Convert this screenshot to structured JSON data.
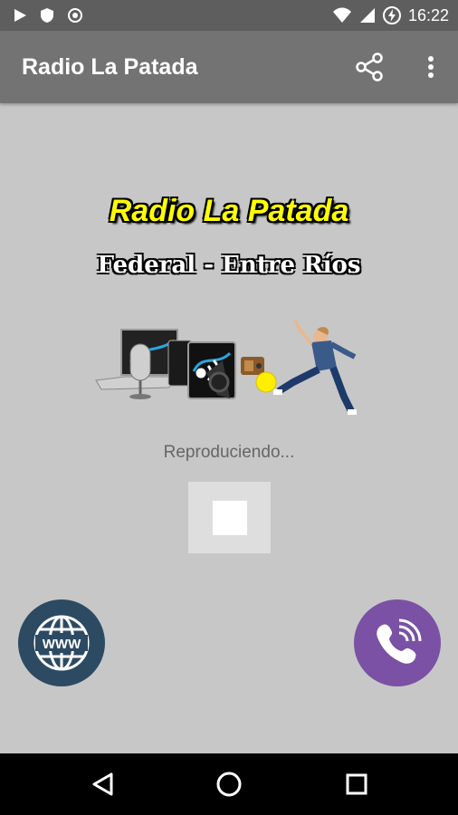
{
  "status_bar": {
    "time": "16:22",
    "icons": [
      "play-icon",
      "shield-icon",
      "radio-target-icon",
      "wifi-icon",
      "signal-icon",
      "battery-icon"
    ]
  },
  "app_bar": {
    "title": "Radio La Patada",
    "actions": [
      "share-icon",
      "more-vert-icon"
    ]
  },
  "logo": {
    "title": "Radio La Patada",
    "subtitle": "Federal - Entre Ríos"
  },
  "player": {
    "status": "Reproduciendo...",
    "control": "stop-icon"
  },
  "fabs": {
    "web_label": "WWW",
    "web_icon": "globe-icon",
    "viber_icon": "viber-phone-icon"
  },
  "colors": {
    "background": "#c7c7c7",
    "app_bar": "#737373",
    "status_bar": "#5e5e5e",
    "title_yellow": "#ffff00",
    "web_fab": "#2d4a63",
    "viber_fab": "#7a51a4"
  },
  "nav_bar": [
    "back-icon",
    "home-icon",
    "recents-icon"
  ]
}
